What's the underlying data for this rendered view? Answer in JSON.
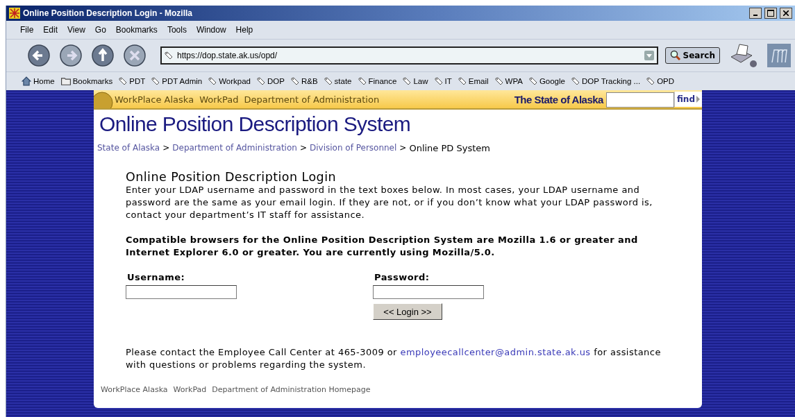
{
  "window": {
    "title": "Online Position Description Login - Mozilla"
  },
  "menu": [
    "File",
    "Edit",
    "View",
    "Go",
    "Bookmarks",
    "Tools",
    "Window",
    "Help"
  ],
  "address": {
    "value": "https://dop.state.ak.us/opd/"
  },
  "search_button": "Search",
  "bookmarks": [
    {
      "label": "Home",
      "kind": "home"
    },
    {
      "label": "Bookmarks",
      "kind": "folder"
    },
    {
      "label": "PDT",
      "kind": "link"
    },
    {
      "label": "PDT Admin",
      "kind": "link"
    },
    {
      "label": "Workpad",
      "kind": "link"
    },
    {
      "label": "DOP",
      "kind": "link"
    },
    {
      "label": "R&B",
      "kind": "link"
    },
    {
      "label": "state",
      "kind": "link"
    },
    {
      "label": "Finance",
      "kind": "link"
    },
    {
      "label": "Law",
      "kind": "link"
    },
    {
      "label": "IT",
      "kind": "link"
    },
    {
      "label": "Email",
      "kind": "link"
    },
    {
      "label": "WPA",
      "kind": "link"
    },
    {
      "label": "Google",
      "kind": "link"
    },
    {
      "label": "DOP Tracking ...",
      "kind": "link"
    },
    {
      "label": "OPD",
      "kind": "link"
    }
  ],
  "header": {
    "links": [
      "WorkPlace Alaska",
      "WorkPad",
      "Department of Administration"
    ],
    "brand": "The State of Alaska",
    "find_button": "find"
  },
  "site_title": "Online Position Description System",
  "breadcrumb": {
    "links": [
      "State of Alaska",
      "Department of Administration",
      "Division of Personnel"
    ],
    "current": "Online PD System",
    "separator": ">"
  },
  "login": {
    "heading": "Online Position Description Login",
    "intro": "Enter your LDAP username and password in the text boxes below. In most cases, your LDAP username and password are the same as your email login. If they are not, or if you don’t know what your LDAP password is, contact your department’s IT staff for assistance.",
    "notice": "Compatible browsers for the Online Position Description System are Mozilla 1.6 or greater and Internet Explorer 6.0 or greater. You are currently using Mozilla/5.0.",
    "username_label": "Username:",
    "password_label": "Password:",
    "button": "<< Login >>"
  },
  "contact": {
    "before": "Please contact the Employee Call Center at 465-3009 or",
    "link": "employeecallcenter@admin.state.ak.us",
    "after": "for assistance with questions or problems regarding the system."
  },
  "footer_links": [
    "WorkPlace Alaska",
    "WorkPad",
    "Department of Administration Homepage"
  ]
}
